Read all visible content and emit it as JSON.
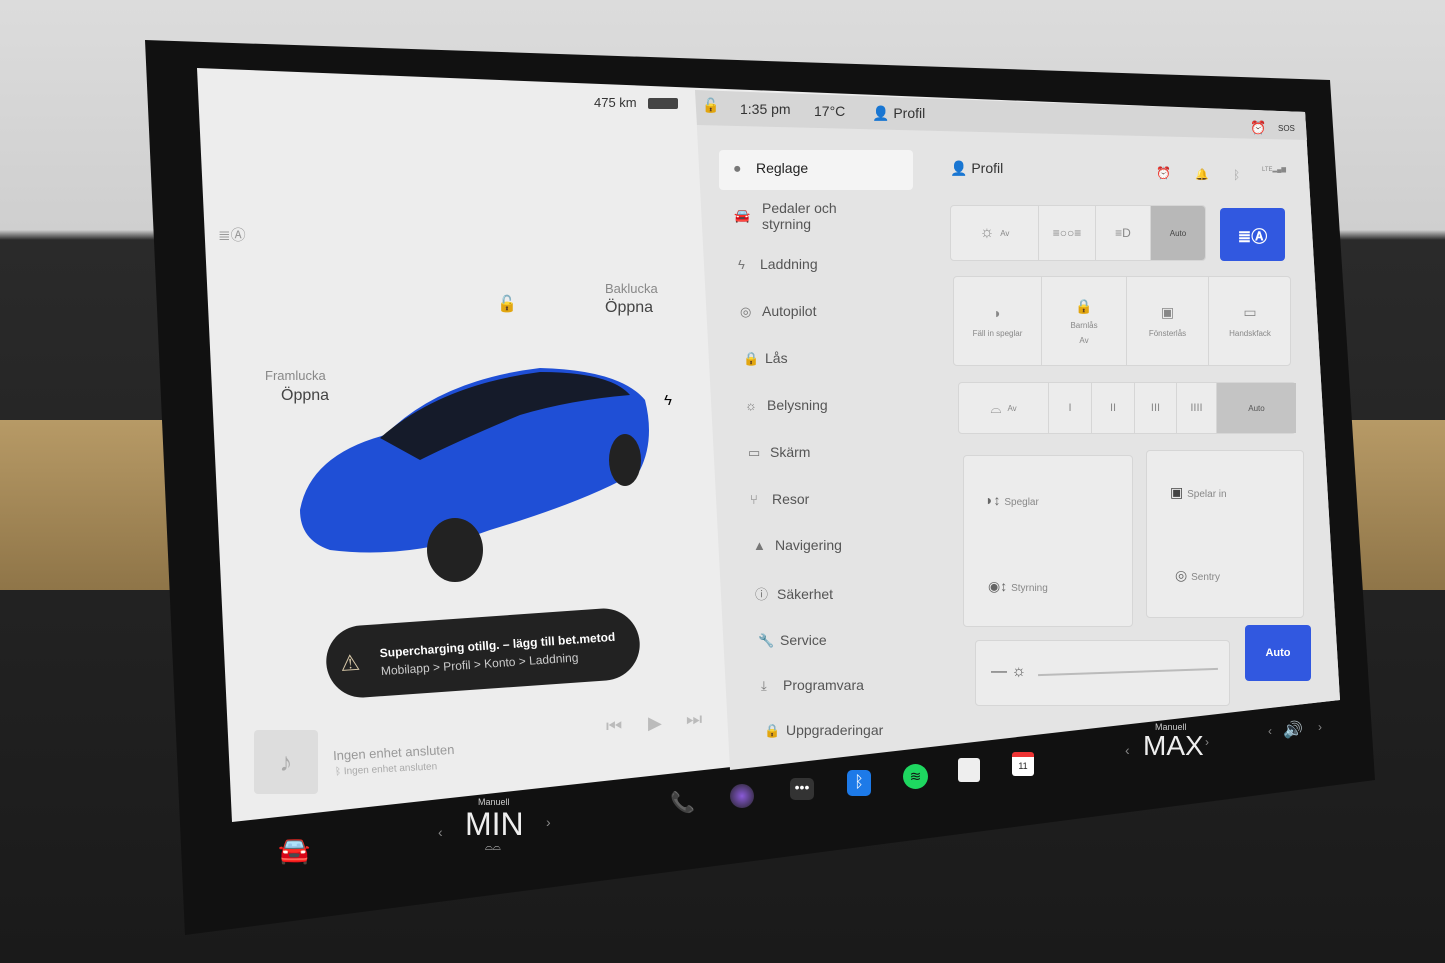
{
  "status": {
    "range": "475 km",
    "time": "1:35 pm",
    "temp": "17°C",
    "profile": "Profil"
  },
  "car": {
    "frunk_label": "Framlucka",
    "frunk_action": "Öppna",
    "trunk_label": "Baklucka",
    "trunk_action": "Öppna"
  },
  "alert": {
    "title": "Supercharging otillg. – lägg till bet.metod",
    "subtitle": "Mobilapp > Profil > Konto > Laddning"
  },
  "media": {
    "title": "Ingen enhet ansluten",
    "subtitle": "Ingen enhet ansluten"
  },
  "menu": [
    {
      "label": "Reglage",
      "icon": "toggle-icon"
    },
    {
      "label": "Pedaler och styrning",
      "icon": "car-icon"
    },
    {
      "label": "Laddning",
      "icon": "bolt-icon"
    },
    {
      "label": "Autopilot",
      "icon": "steering-wheel-icon"
    },
    {
      "label": "Lås",
      "icon": "lock-icon"
    },
    {
      "label": "Belysning",
      "icon": "sun-icon"
    },
    {
      "label": "Skärm",
      "icon": "display-icon"
    },
    {
      "label": "Resor",
      "icon": "trips-icon"
    },
    {
      "label": "Navigering",
      "icon": "navigation-icon"
    },
    {
      "label": "Säkerhet",
      "icon": "safety-icon"
    },
    {
      "label": "Service",
      "icon": "wrench-icon"
    },
    {
      "label": "Programvara",
      "icon": "download-icon"
    },
    {
      "label": "Uppgraderingar",
      "icon": "bag-icon"
    }
  ],
  "panel": {
    "profile": "Profil",
    "lights": {
      "off": "Av",
      "auto": "Auto"
    },
    "controls": [
      {
        "label": "Fäll in speglar"
      },
      {
        "label": "Barnlås",
        "sub": "Av"
      },
      {
        "label": "Fönsterlås"
      },
      {
        "label": "Handskfack"
      }
    ],
    "wipers": {
      "off": "Av",
      "speeds": [
        "I",
        "II",
        "III",
        "IIII"
      ],
      "auto": "Auto"
    },
    "mirrors": "Speglar",
    "steering": "Styrning",
    "dashcam": "Spelar in",
    "sentry": "Sentry",
    "brightness_auto": "Auto"
  },
  "climate": {
    "left_mode": "Manuell",
    "left_value": "MIN",
    "right_mode": "Manuell",
    "right_value": "MAX"
  },
  "dock": {
    "calendar_day": "11"
  },
  "colors": {
    "accent": "#3158e0",
    "alarm": "#f08a3c",
    "phone": "#2fcf4f"
  }
}
